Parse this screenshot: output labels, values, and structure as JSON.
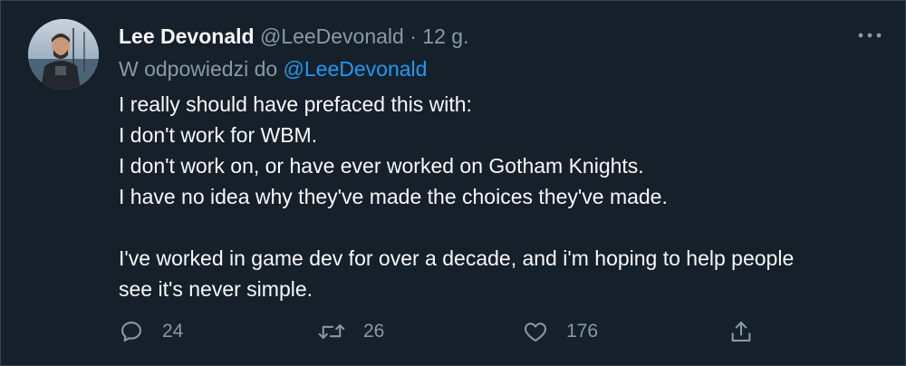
{
  "author": {
    "display_name": "Lee Devonald",
    "handle": "@LeeDevonald",
    "separator": "·",
    "timestamp": "12 g."
  },
  "reply_context": {
    "prefix": "W odpowiedzi do",
    "mention": "@LeeDevonald"
  },
  "tweet": {
    "lines": [
      "I really should have prefaced this with:",
      "I don't work for WBM.",
      "I don't work on, or have ever worked on Gotham Knights.",
      "I have no idea why they've made the choices they've made.",
      "",
      "I've worked in game dev for over a decade, and i'm hoping to help people",
      "see it's never simple."
    ]
  },
  "actions": {
    "reply_count": "24",
    "retweet_count": "26",
    "like_count": "176"
  },
  "icons": {
    "more": "more-horizontal-icon",
    "reply": "reply-icon",
    "retweet": "retweet-icon",
    "like": "heart-icon",
    "share": "share-icon"
  },
  "colors": {
    "background": "#15202b",
    "border": "#38444d",
    "text_primary": "#f7f9f9",
    "text_secondary": "#8b98a5",
    "accent": "#1d9bf0"
  }
}
